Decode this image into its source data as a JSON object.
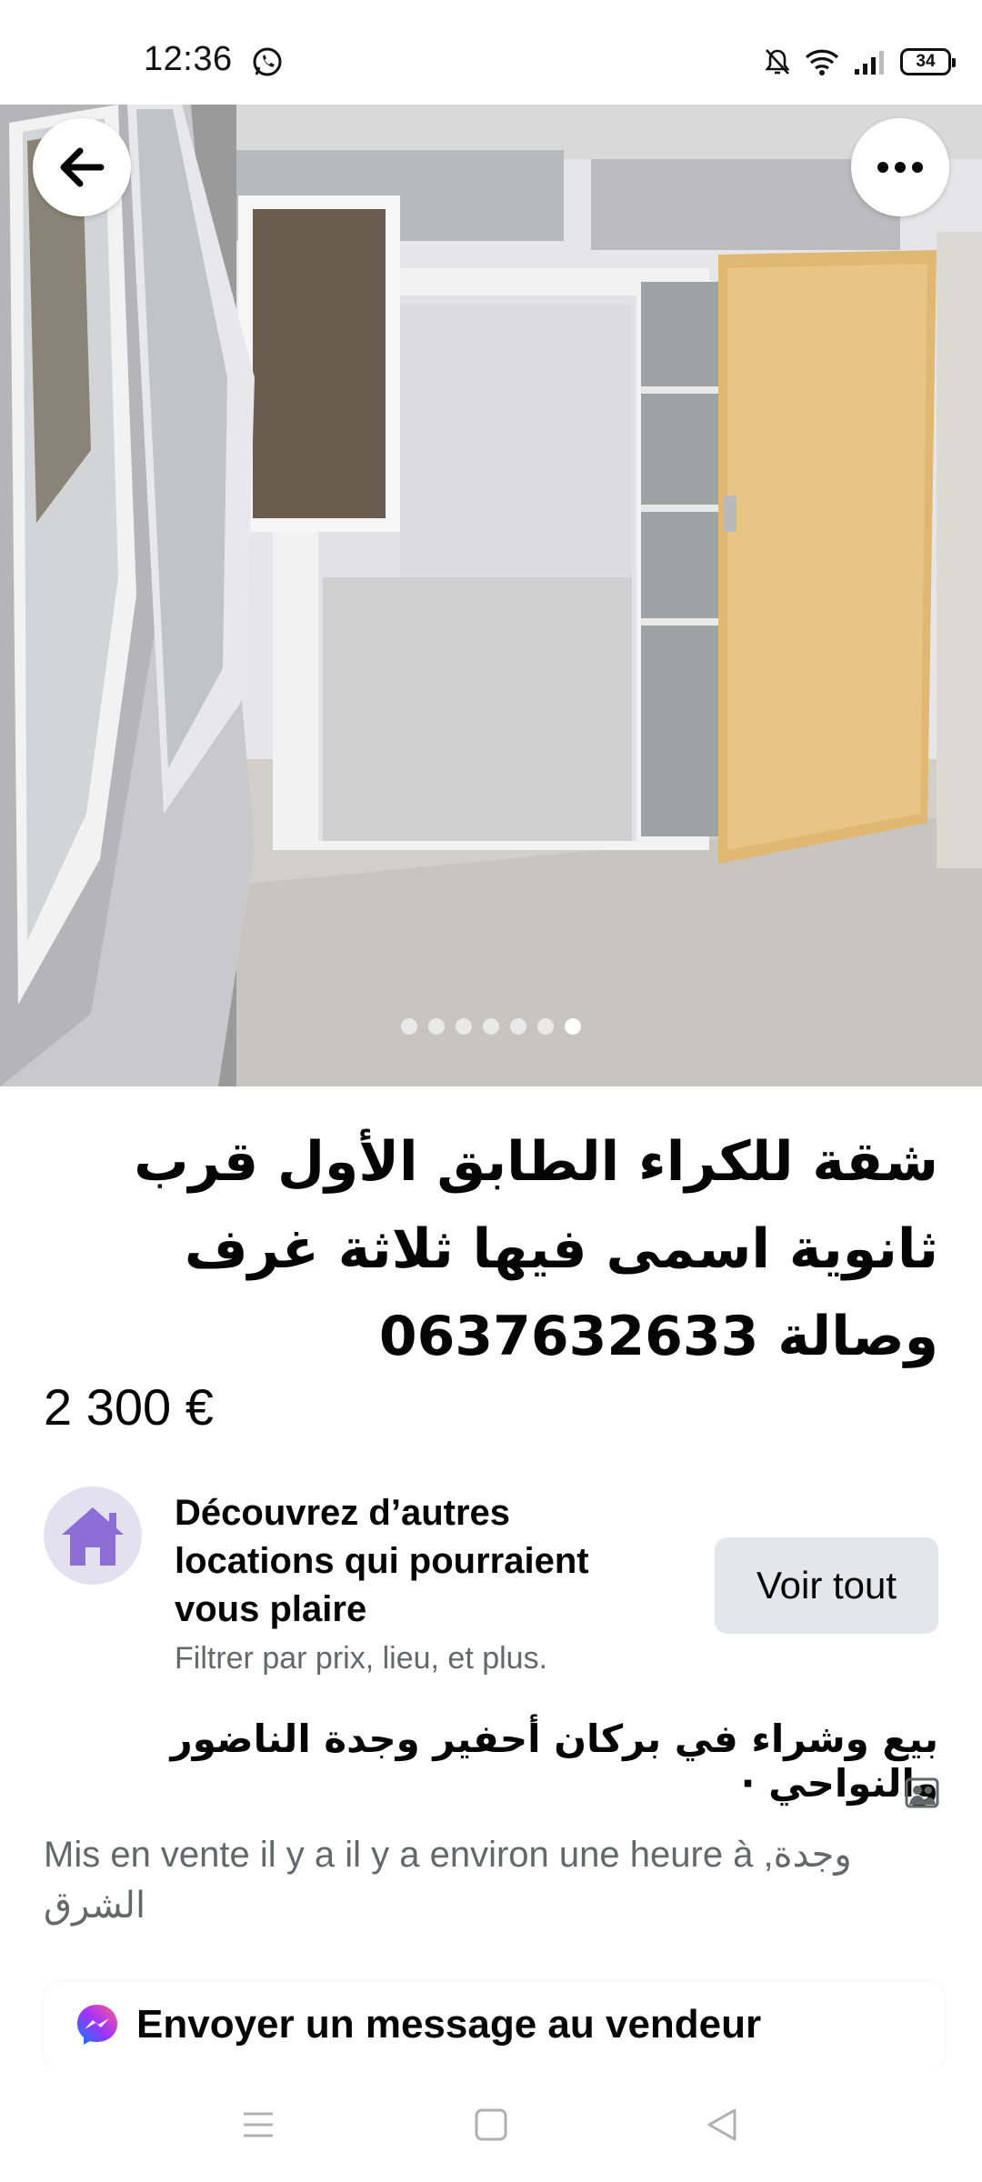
{
  "status_bar": {
    "time": "12:36",
    "battery": "34"
  },
  "photo": {
    "dots_total": 7,
    "active_dot_index": 6
  },
  "listing": {
    "title": "شقة للكراء الطابق الأول قرب ثانوية اسمى فيها ثلاثة  غرف وصالة 0637632633",
    "price": "2 300 €"
  },
  "discover": {
    "title": "Découvrez d’autres locations qui pourraient vous plaire",
    "subtitle": "Filtrer par prix, lieu, et plus.",
    "button": "Voir tout"
  },
  "group": {
    "name": "بيع وشراء في بركان أحفير وجدة الناضور والنواحي ·"
  },
  "listed_info": "Mis en vente il y a il y a environ une heure à ,وجدة الشرق",
  "message": {
    "button": "Envoyer un message au vendeur"
  },
  "colors": {
    "accent_purple": "#8b6fd6",
    "secondary_text": "#65676b",
    "button_gray": "#e4e6eb"
  }
}
